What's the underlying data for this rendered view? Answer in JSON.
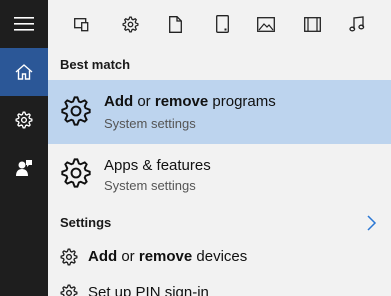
{
  "sidebar": {
    "items": [
      {
        "icon": "hamburger-menu-icon"
      },
      {
        "icon": "home-icon"
      },
      {
        "icon": "gear-icon"
      },
      {
        "icon": "person-feedback-icon"
      }
    ],
    "active_color": "#2b5797",
    "background": "#1e1e1e"
  },
  "filters": [
    {
      "icon": "apps-icon"
    },
    {
      "icon": "settings-gear-icon"
    },
    {
      "icon": "document-icon"
    },
    {
      "icon": "tablet-icon"
    },
    {
      "icon": "photo-icon"
    },
    {
      "icon": "video-film-icon"
    },
    {
      "icon": "music-note-icon"
    }
  ],
  "best_match": {
    "header": "Best match",
    "items": [
      {
        "icon": "gear-icon",
        "title_parts": [
          {
            "text": "Add",
            "bold": true
          },
          {
            "text": " or ",
            "bold": false
          },
          {
            "text": "remove",
            "bold": true
          },
          {
            "text": " programs",
            "bold": false
          }
        ],
        "subtitle": "System settings",
        "selected": true
      },
      {
        "icon": "gear-icon",
        "title_parts": [
          {
            "text": "Apps & features",
            "bold": false
          }
        ],
        "subtitle": "System settings",
        "selected": false
      }
    ],
    "highlight_color": "#bdd4ee"
  },
  "settings": {
    "header": "Settings",
    "items": [
      {
        "icon": "gear-icon",
        "title_parts": [
          {
            "text": "Add",
            "bold": true
          },
          {
            "text": " or ",
            "bold": false
          },
          {
            "text": "remove",
            "bold": true
          },
          {
            "text": " devices",
            "bold": false
          }
        ]
      },
      {
        "icon": "gear-icon",
        "title_parts": [
          {
            "text": "Set up PIN sign-in",
            "bold": false
          }
        ]
      }
    ]
  }
}
